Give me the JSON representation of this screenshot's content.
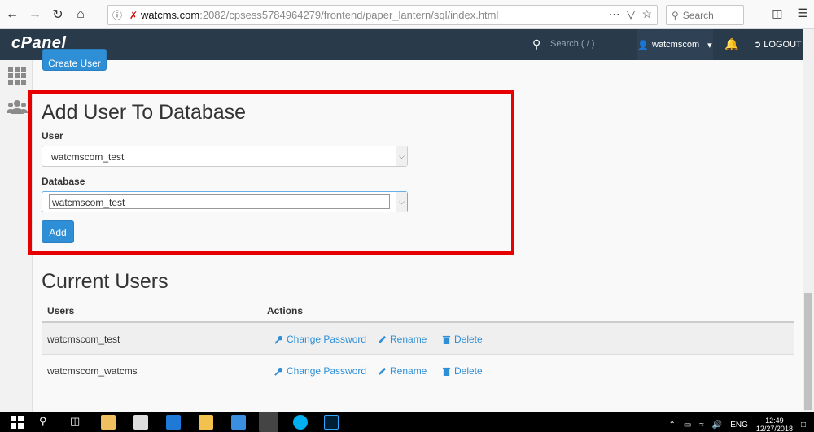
{
  "browser": {
    "url_host": "watcms.com",
    "url_path": ":2082/cpsess5784964279/frontend/paper_lantern/sql/index.html",
    "search_placeholder": "Search"
  },
  "cpanel": {
    "logo": "cPanel",
    "search_placeholder": "Search ( / )",
    "username": "watcmscom",
    "logout_label": "LOGOUT"
  },
  "page": {
    "create_user_label": "Create User",
    "add_user_title": "Add User To Database",
    "user_label": "User",
    "user_selected": "watcmscom_test",
    "database_label": "Database",
    "database_selected": "watcmscom_test",
    "add_button_label": "Add",
    "current_users_title": "Current Users"
  },
  "table": {
    "headers": [
      "Users",
      "Actions"
    ],
    "action_labels": [
      "Change Password",
      "Rename",
      "Delete"
    ],
    "rows": [
      {
        "user": "watcmscom_test"
      },
      {
        "user": "watcmscom_watcms"
      }
    ]
  },
  "taskbar": {
    "lang": "ENG",
    "time": "12:49",
    "date": "12/27/2018"
  },
  "colors": {
    "accent": "#2f8fd6",
    "header": "#293a4a",
    "highlight": "#e60000"
  }
}
